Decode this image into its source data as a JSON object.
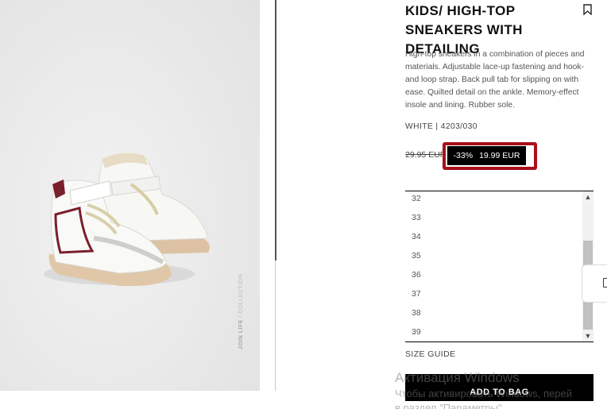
{
  "product": {
    "image_alt": "White kids high-top sneaker with burgundy details",
    "watermark_brand": "JOIN LIFE",
    "watermark_label": "COLLECTION",
    "title": "KIDS/ HIGH-TOP SNEAKERS WITH DETAILING",
    "description": "High-top sneakers in a combination of pieces and materials. Adjustable lace-up fastening and hook-and loop strap. Back pull tab for slipping on with ease. Quilted detail on the ankle. Memory-effect insole and lining. Rubber sole.",
    "color_ref": "WHITE | 4203/030",
    "old_price": "29.95 EUR",
    "discount": "-33%",
    "new_price": "19.99 EUR"
  },
  "sizes": [
    "32",
    "33",
    "34",
    "35",
    "36",
    "37",
    "38",
    "39"
  ],
  "size_guide_label": "SIZE GUIDE",
  "add_to_bag_label": "ADD TO BAG",
  "windows_overlay": {
    "line1": "Активация Windows",
    "line2": "Чтобы активировать Windows, перей",
    "line3": "в раздел \"Параметры\"."
  },
  "colors": {
    "highlight": "#a8101a",
    "price_bg": "#000000",
    "accent_burgundy": "#7a1f2b"
  },
  "icons": {
    "bookmark": "bookmark-icon",
    "scroll_up": "chevron-up-icon",
    "scroll_down": "chevron-down-icon"
  }
}
